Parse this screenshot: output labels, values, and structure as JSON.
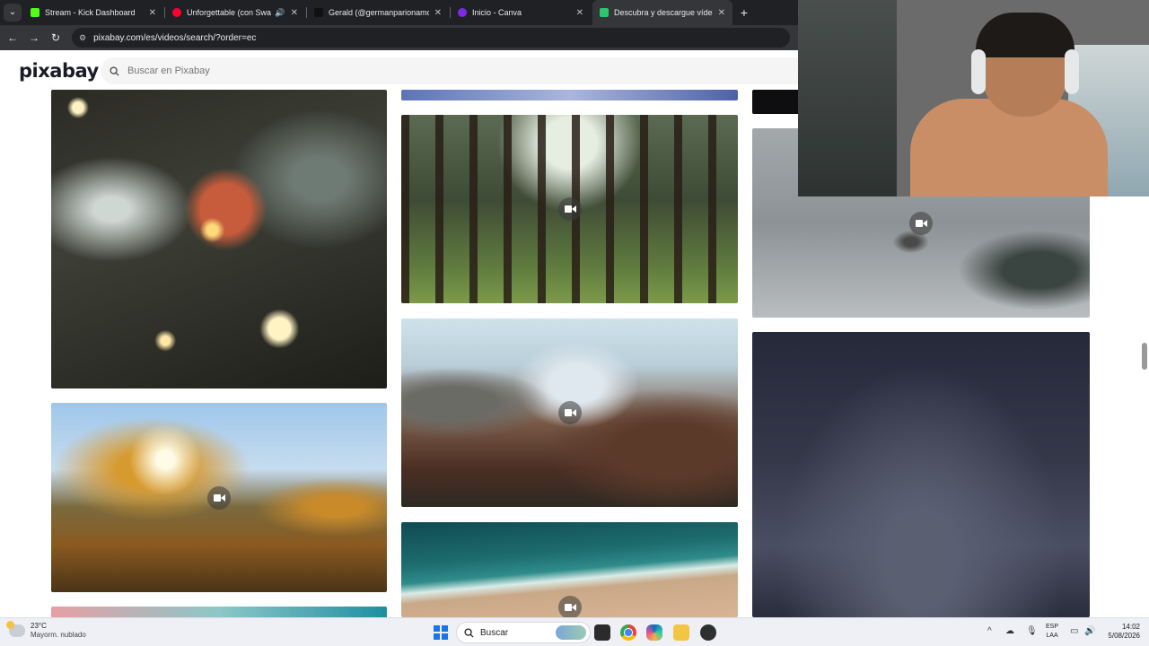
{
  "browser": {
    "tabs": [
      {
        "title": "Stream - Kick Dashboard",
        "favicon_color": "#53fc18"
      },
      {
        "title": "Unforgettable (con Swae Le",
        "favicon_color": "#ff0033"
      },
      {
        "title": "Gerald (@germanparionamont",
        "favicon_color": "#111111"
      },
      {
        "title": "Inicio - Canva",
        "favicon_color": "#7d2ae8"
      },
      {
        "title": "Descubra y descargue vídeos g",
        "favicon_color": "#2ec66d"
      }
    ],
    "url": "pixabay.com/es/videos/search/?order=ec"
  },
  "pixabay": {
    "logo": "pixabay",
    "search_placeholder": "Buscar en Pixabay"
  },
  "taskbar": {
    "weather_temp": "23°C",
    "weather_condition": "Mayorm. nublado",
    "search_label": "Buscar",
    "lang_line1": "ESP",
    "lang_line2": "LAA",
    "time": "14:02",
    "date": "5/08/2026"
  },
  "colors": {
    "chrome_dark": "#202124",
    "chrome_toolbar": "#35363a",
    "pixabay_search_bg": "#f5f5f5",
    "taskbar_bg": "#eef0f5"
  }
}
